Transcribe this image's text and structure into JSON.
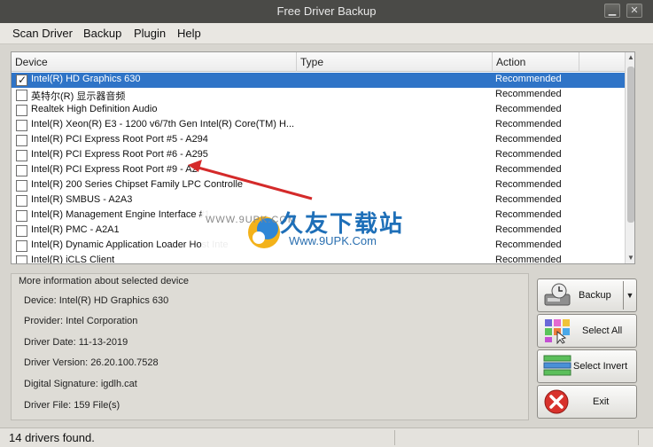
{
  "window": {
    "title": "Free Driver Backup",
    "minimize_glyph": "▁",
    "close_glyph": "✕"
  },
  "menu": [
    "Scan Driver",
    "Backup",
    "Plugin",
    "Help"
  ],
  "list": {
    "columns": {
      "device": "Device",
      "type": "Type",
      "action": "Action"
    },
    "rows": [
      {
        "checked": true,
        "selected": true,
        "device": "Intel(R) HD Graphics 630",
        "type": "",
        "action": "Recommended"
      },
      {
        "checked": false,
        "selected": false,
        "device": "英特尔(R) 显示器音频",
        "type": "",
        "action": "Recommended"
      },
      {
        "checked": false,
        "selected": false,
        "device": "Realtek High Definition Audio",
        "type": "",
        "action": "Recommended"
      },
      {
        "checked": false,
        "selected": false,
        "device": "Intel(R) Xeon(R) E3 - 1200 v6/7th Gen Intel(R) Core(TM) H...",
        "type": "",
        "action": "Recommended"
      },
      {
        "checked": false,
        "selected": false,
        "device": "Intel(R) PCI Express Root Port #5 - A294",
        "type": "",
        "action": "Recommended"
      },
      {
        "checked": false,
        "selected": false,
        "device": "Intel(R) PCI Express Root Port #6 - A295",
        "type": "",
        "action": "Recommended"
      },
      {
        "checked": false,
        "selected": false,
        "device": "Intel(R) PCI Express Root Port #9 - A2",
        "type": "",
        "action": "Recommended"
      },
      {
        "checked": false,
        "selected": false,
        "device": "Intel(R) 200 Series Chipset Family LPC Controlle",
        "type": "",
        "action": "Recommended"
      },
      {
        "checked": false,
        "selected": false,
        "device": "Intel(R) SMBUS - A2A3",
        "type": "",
        "action": "Recommended"
      },
      {
        "checked": false,
        "selected": false,
        "device": "Intel(R) Management Engine Interface #1",
        "type": "",
        "action": "Recommended"
      },
      {
        "checked": false,
        "selected": false,
        "device": "Intel(R) PMC - A2A1",
        "type": "",
        "action": "Recommended"
      },
      {
        "checked": false,
        "selected": false,
        "device": "Intel(R) Dynamic Application Loader Host Inte",
        "type": "",
        "action": "Recommended"
      },
      {
        "checked": false,
        "selected": false,
        "device": "Intel(R) iCLS Client",
        "type": "",
        "action": "Recommended"
      }
    ],
    "scroll_up_glyph": "▲",
    "scroll_down_glyph": "▼"
  },
  "info": {
    "title": "More information about selected device",
    "device": "Device:  Intel(R) HD Graphics 630",
    "provider": "Provider: Intel Corporation",
    "driver_date": "Driver Date:  11-13-2019",
    "driver_version": "Driver Version:  26.20.100.7528",
    "digital_signature": "Digital Signature:  igdlh.cat",
    "driver_file": "Driver File:  159 File(s)"
  },
  "buttons": {
    "backup": "Backup",
    "backup_dropdown_glyph": "▼",
    "select_all": "Select All",
    "select_invert": "Select Invert",
    "exit": "Exit"
  },
  "status": {
    "text": "14 drivers found."
  },
  "watermark": {
    "small": "WWW.9UPK.COM",
    "big": "久友下载站",
    "url": "Www.9UPK.Com"
  },
  "colors": {
    "selection": "#2f74c7",
    "exit_red": "#d8322c",
    "arrow_red": "#d42a2a"
  },
  "icons": {
    "backup": "hard-drive-clock-icon",
    "select_all": "colored-grid-cursor-icon",
    "select_invert": "stacked-bars-icon",
    "exit": "red-x-icon"
  }
}
